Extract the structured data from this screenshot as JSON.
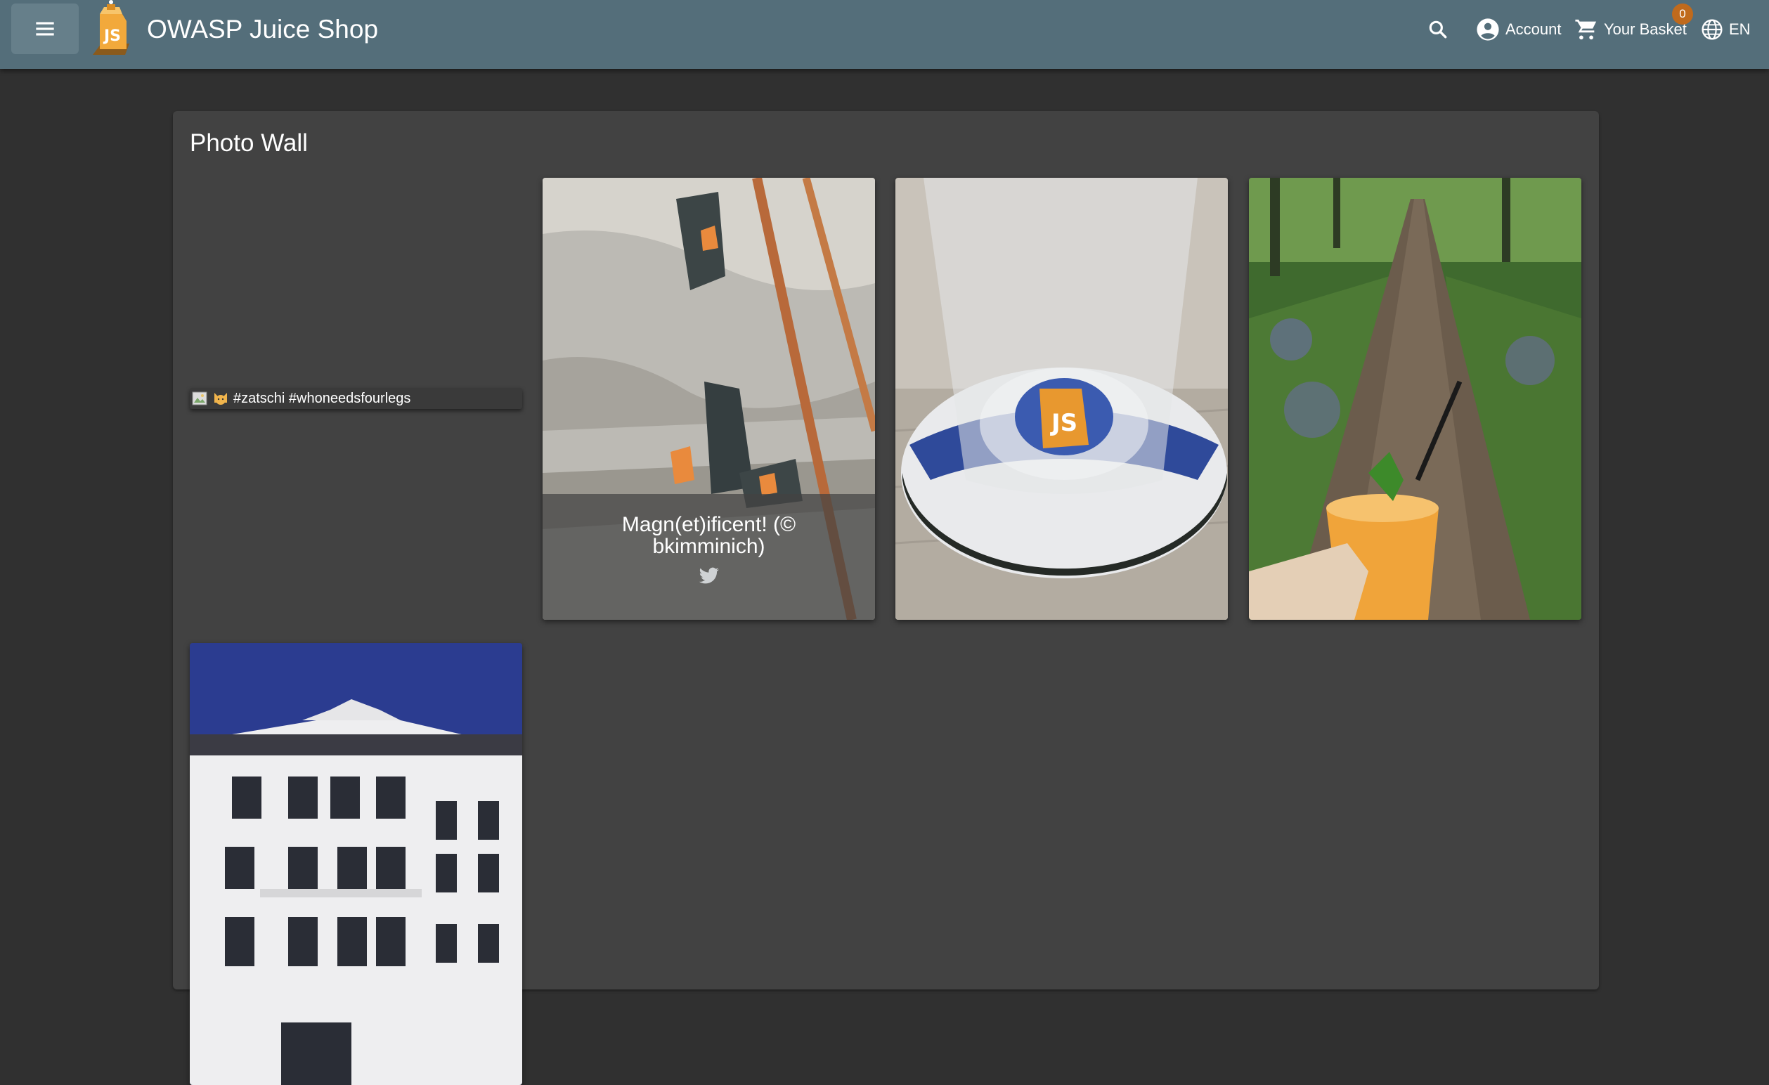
{
  "header": {
    "title": "OWASP Juice Shop",
    "account_label": "Account",
    "basket_label": "Your Basket",
    "basket_count": "0",
    "language_label": "EN",
    "icons": [
      "menu-icon",
      "juice-shop-logo",
      "search-icon",
      "account-circle-icon",
      "shopping-cart-icon",
      "language-icon"
    ]
  },
  "page": {
    "title": "Photo Wall"
  },
  "photos": [
    {
      "caption": "#zatschi #whoneedsfourlegs",
      "image_broken": true
    },
    {
      "caption": "Magn(et)ificent! (© bkimminich)",
      "show_caption": true,
      "social_icon": "twitter-icon"
    },
    {
      "caption": "",
      "subject": "juice shop sticker under a glass"
    },
    {
      "caption": "",
      "subject": "juice cup on a forest path"
    },
    {
      "caption": "",
      "subject": "white building facade"
    }
  ],
  "colors": {
    "toolbar": "#546e7a",
    "background": "#303030",
    "card": "#424242",
    "badge": "#c06a1c"
  }
}
